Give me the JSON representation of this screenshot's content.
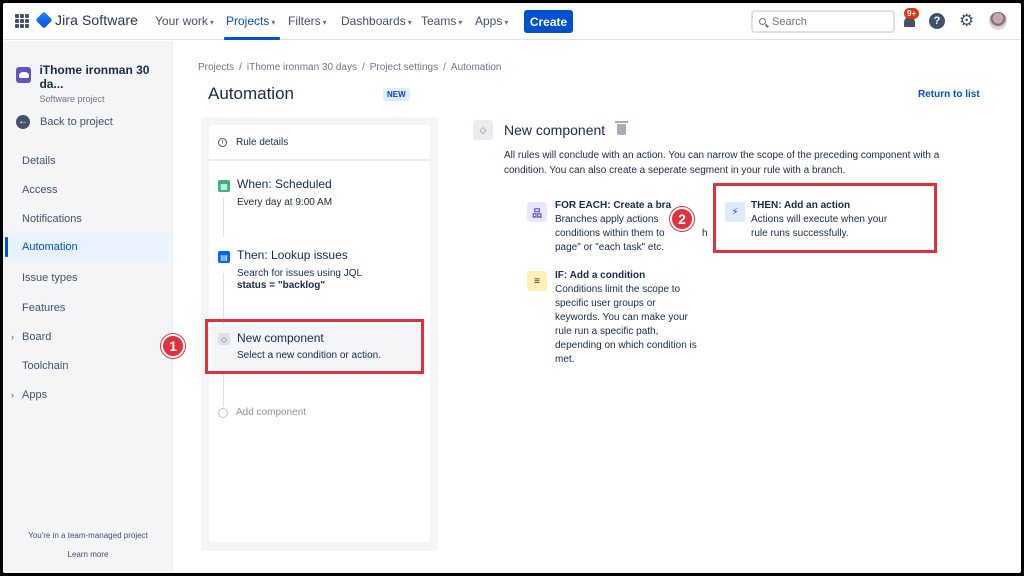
{
  "topnav": {
    "product": "Jira Software",
    "items": [
      {
        "label": "Your work"
      },
      {
        "label": "Projects"
      },
      {
        "label": "Filters"
      },
      {
        "label": "Dashboards"
      },
      {
        "label": "Teams"
      },
      {
        "label": "Apps"
      }
    ],
    "create_label": "Create",
    "search_placeholder": "Search",
    "notifications_badge": "9+",
    "help_label": "?"
  },
  "sidebar": {
    "project_name": "iThome ironman 30 da...",
    "project_type": "Software project",
    "back_label": "Back to project",
    "items": [
      {
        "label": "Details"
      },
      {
        "label": "Access"
      },
      {
        "label": "Notifications"
      },
      {
        "label": "Automation"
      },
      {
        "label": "Issue types"
      },
      {
        "label": "Features"
      },
      {
        "label": "Board"
      },
      {
        "label": "Toolchain"
      },
      {
        "label": "Apps"
      }
    ],
    "footer_text": "You're in a team-managed project",
    "learn_more": "Learn more"
  },
  "breadcrumbs": [
    "Projects",
    "iThome ironman 30 days",
    "Project settings",
    "Automation"
  ],
  "page": {
    "title": "Automation",
    "lozenge": "NEW",
    "return_link": "Return to list"
  },
  "rule": {
    "details_label": "Rule details",
    "trigger_title": "When: Scheduled",
    "trigger_sub": "Every day at 9:00 AM",
    "action_title": "Then: Lookup issues",
    "action_sub": "Search for issues using JQL",
    "action_jql": "status = \"backlog\"",
    "new_title": "New component",
    "new_sub": "Select a new condition or action.",
    "add_component": "Add component"
  },
  "annotations": [
    "1",
    "2"
  ],
  "component_panel": {
    "title": "New component",
    "description": "All rules will conclude with an action. You can narrow the scope of the preceding component with a condition. You can also create a seperate segment in your rule with a branch.",
    "options": [
      {
        "title": "FOR EACH: Create a bra",
        "desc": [
          "Branches apply actions",
          "conditions within them to",
          "page\" or \"each task\" etc."
        ],
        "desc_tail": "h"
      },
      {
        "title": "THEN: Add an action",
        "desc": [
          "Actions will execute when your",
          "rule runs successfully."
        ]
      },
      {
        "title": "IF: Add a condition",
        "desc": [
          "Conditions limit the scope to",
          "specific user groups or",
          "keywords. You can make your",
          "rule run a specific path,",
          "depending on which condition is",
          "met."
        ]
      }
    ]
  },
  "colors": {
    "brand": "#0052cc",
    "annotation_red": "#e0313d",
    "trigger_icon": "#36b37e",
    "action_icon": "#0065ff",
    "branch_icon": "#6554c0",
    "condition_icon": "#ffc400"
  }
}
